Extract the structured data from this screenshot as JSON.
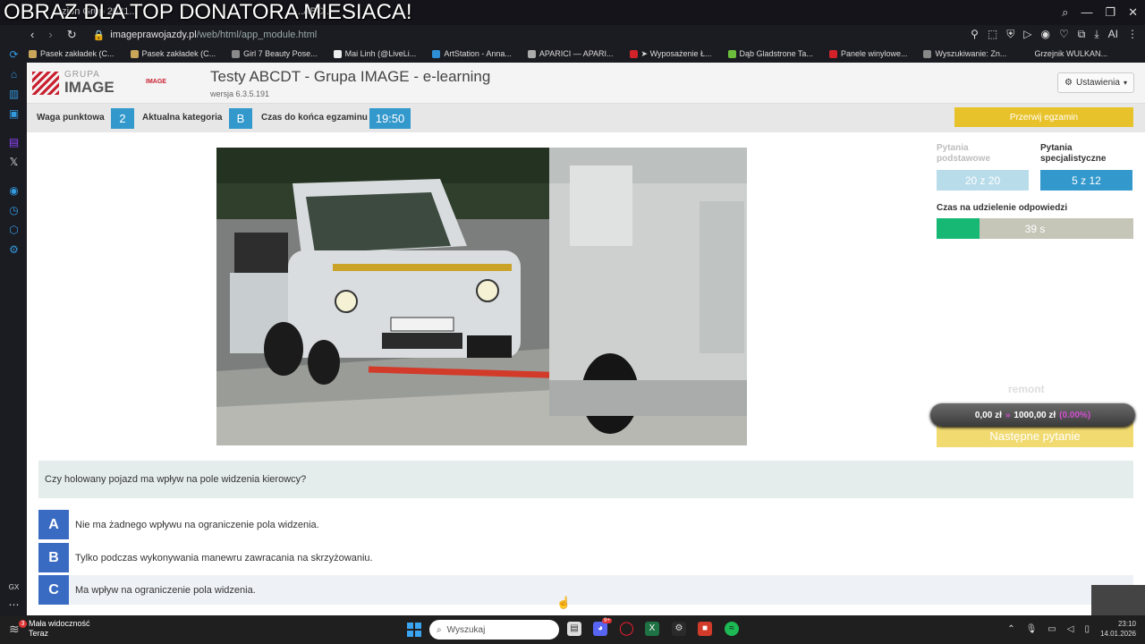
{
  "overlay": {
    "banner": "OBRAZ DLA TOP DONATORA MIESIACA!"
  },
  "browser": {
    "tab_fragments": [
      "...zion Grup 2021...",
      "...ABC..."
    ],
    "url_host": "imageprawojazdy.pl",
    "url_path": "/web/html/app_module.html",
    "ext_label": "AI",
    "bookmarks": [
      {
        "label": "Pasek zakładek (C...",
        "color": "#c9a65a"
      },
      {
        "label": "Pasek zakładek (C...",
        "color": "#c9a65a"
      },
      {
        "label": "Girl 7 Beauty Pose...",
        "color": "#8a8a8a"
      },
      {
        "label": "Mai Linh (@LiveLi...",
        "color": "#eeeeee"
      },
      {
        "label": "ArtStation - Anna...",
        "color": "#2f8fd6"
      },
      {
        "label": "APARICI — APARI...",
        "color": "#aaaaaa"
      },
      {
        "label": "➤ Wyposażenie Ł...",
        "color": "#d2232a"
      },
      {
        "label": "Dąb Gladstrone Ta...",
        "color": "#6cbf3c"
      },
      {
        "label": "Panele winylowe...",
        "color": "#d2232a"
      },
      {
        "label": "Wyszukiwanie: Zn...",
        "color": "#888888"
      },
      {
        "label": "Grzejnik WULKAN...",
        "color": "#1b1b22"
      }
    ]
  },
  "app": {
    "logo_group": "GRUPA",
    "logo_name": "IMAGE",
    "logo_small": "IMAGE",
    "title": "Testy ABCDT - Grupa IMAGE - e-learning",
    "version": "wersja 6.3.5.191",
    "settings_label": "Ustawienia"
  },
  "infobar": {
    "weight_label": "Waga punktowa",
    "weight_value": "2",
    "category_label": "Aktualna kategoria",
    "category_value": "B",
    "time_label": "Czas do końca egzaminu",
    "time_value": "19:50",
    "stop_label": "Przerwij egzamin"
  },
  "stats": {
    "basic_label": "Pytania podstawowe",
    "basic_value": "20 z 20",
    "special_label": "Pytania specjalistyczne",
    "special_value": "5 z 12",
    "answer_time_label": "Czas na udzielenie odpowiedzi",
    "answer_time_value": "39 s",
    "answer_time_fraction": 0.22,
    "colors": {
      "basic_bg": "#b9dcea",
      "special_bg": "#3398cc",
      "timer_fill": "#17b873"
    }
  },
  "donation": {
    "text_left": "0,00 zł",
    "arrow": "»",
    "text_right": "1000,00 zł",
    "pct": "(0.00%)",
    "title": "remont"
  },
  "next_label": "Następne pytanie",
  "question": "Czy holowany pojazd ma wpływ na pole widzenia kierowcy?",
  "answers": [
    {
      "letter": "A",
      "text": "Nie ma żadnego wpływu na ograniczenie pola widzenia."
    },
    {
      "letter": "B",
      "text": "Tylko podczas wykonywania manewru zawracania na skrzyżowaniu."
    },
    {
      "letter": "C",
      "text": "Ma wpływ na ograniczenie pola widzenia."
    }
  ],
  "taskbar": {
    "weather_badge": "3",
    "weather_line1": "Mała widoczność",
    "weather_line2": "Teraz",
    "search_placeholder": "Wyszukaj",
    "discord_badge": "9+",
    "time": "23:10",
    "date": "14.01.2026"
  }
}
